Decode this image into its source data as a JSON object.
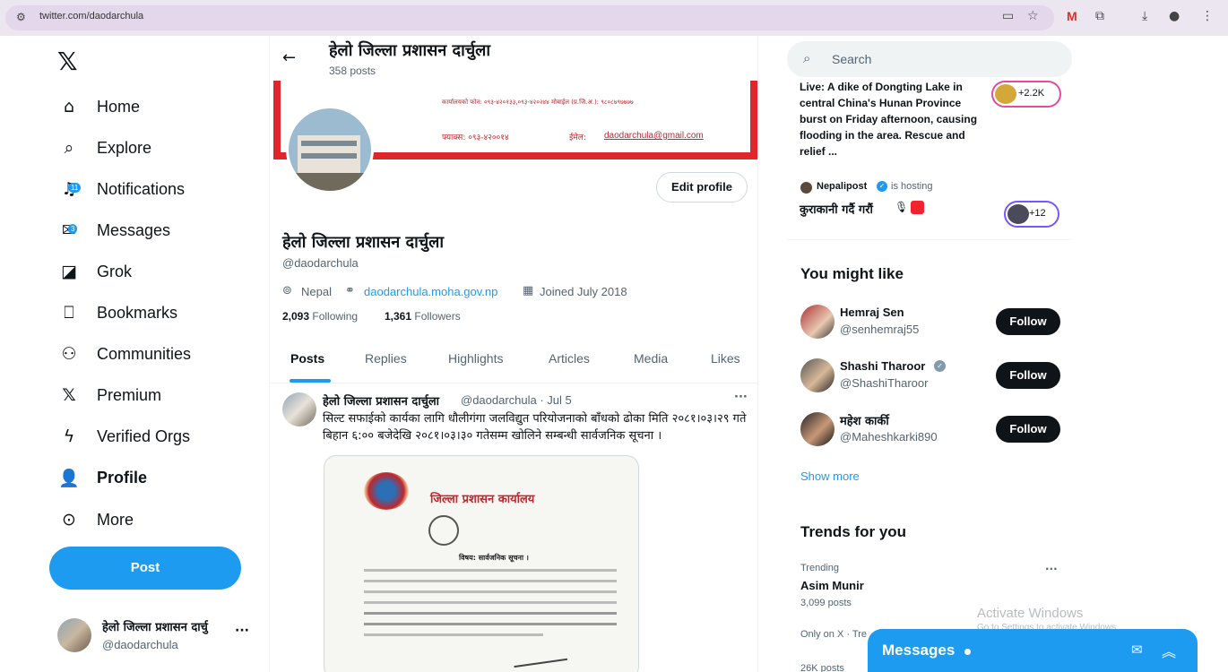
{
  "browser": {
    "url": "twitter.com/daodarchula"
  },
  "nav": {
    "items": [
      {
        "label": "Home",
        "icon": "home-icon"
      },
      {
        "label": "Explore",
        "icon": "search-icon"
      },
      {
        "label": "Notifications",
        "icon": "bell-icon",
        "badge": "11"
      },
      {
        "label": "Messages",
        "icon": "envelope-icon",
        "badge": "3"
      },
      {
        "label": "Grok",
        "icon": "grok-icon"
      },
      {
        "label": "Bookmarks",
        "icon": "bookmark-icon"
      },
      {
        "label": "Communities",
        "icon": "people-icon"
      },
      {
        "label": "Premium",
        "icon": "x-icon"
      },
      {
        "label": "Verified Orgs",
        "icon": "lightning-icon"
      },
      {
        "label": "Profile",
        "icon": "person-icon"
      },
      {
        "label": "More",
        "icon": "more-circle-icon"
      }
    ],
    "post_label": "Post",
    "account_name": "हेलो जिल्ला प्रशासन दार्चु",
    "account_handle": "@daodarchula"
  },
  "header": {
    "title": "हेलो जिल्ला प्रशासन दार्चुला",
    "posts_count": "358 posts"
  },
  "banner": {
    "line1": "कार्यालयको फोन: ०९३-४२०१३३,०९३-४२०२४४ मोबाईल (प्र.जि.अ.): ९८०८७९७७७७",
    "fax": "फ्याक्स: ०९३-४२००१४",
    "email_label": "ईमेल:",
    "email": "daodarchula@gmail.com"
  },
  "profile": {
    "edit_label": "Edit profile",
    "name": "हेलो जिल्ला प्रशासन दार्चुला",
    "handle": "@daodarchula",
    "location": "Nepal",
    "website": "daodarchula.moha.gov.np",
    "joined": "Joined July 2018",
    "following_count": "2,093",
    "following_label": "Following",
    "followers_count": "1,361",
    "followers_label": "Followers"
  },
  "tabs": [
    "Posts",
    "Replies",
    "Highlights",
    "Articles",
    "Media",
    "Likes"
  ],
  "tweet": {
    "author": "हेलो जिल्ला प्रशासन दार्चुला",
    "handle_date": "@daodarchula · Jul 5",
    "more": "···",
    "text": "सिल्ट सफाईको कार्यका लागि धौलीगंगा जलविद्युत परियोजनाको बाँधको ढोका मिति २०८१।०३।२९ गते बिहान ६:०० बजेदेखि २०८१।०३।३० गतेसम्म खोलिने सम्बन्धी सार्वजनिक सूचना ।",
    "doc_heading": "जिल्ला प्रशासन कार्यालय",
    "doc_subject": "विषय: सार्वजनिक सूचना ।"
  },
  "right": {
    "search_placeholder": "Search",
    "news_text": "Live: A dike of Dongting Lake in central China's Hunan Province burst on Friday afternoon, causing flooding in the area. Rescue and relief ...",
    "news_count": "+2.2K",
    "space_host": "Nepalipost",
    "space_status": "is hosting",
    "space_title": "कुराकानी गर्दै गरौं",
    "space_count": "+12",
    "might_like_title": "You might like",
    "suggestions": [
      {
        "name": "Hemraj Sen",
        "handle": "@senhemraj55",
        "follow": "Follow"
      },
      {
        "name": "Shashi Tharoor",
        "handle": "@ShashiTharoor",
        "follow": "Follow"
      },
      {
        "name": "महेश कार्की",
        "handle": "@Maheshkarki890",
        "follow": "Follow"
      }
    ],
    "show_more": "Show more",
    "trends_title": "Trends for you",
    "trend_label": "Trending",
    "trend_name": "Asim Munir",
    "trend_posts": "3,099 posts",
    "trend2_label": "Only on X · Tre",
    "trend2_posts": "26K posts",
    "trend_more": "···"
  },
  "messages_bar": {
    "label": "Messages"
  },
  "watermark": {
    "line1": "Activate Windows",
    "line2": "Go to Settings to activate Windows."
  },
  "colors": {
    "accent": "#1d9bf0",
    "banner_red": "#e0262b"
  }
}
